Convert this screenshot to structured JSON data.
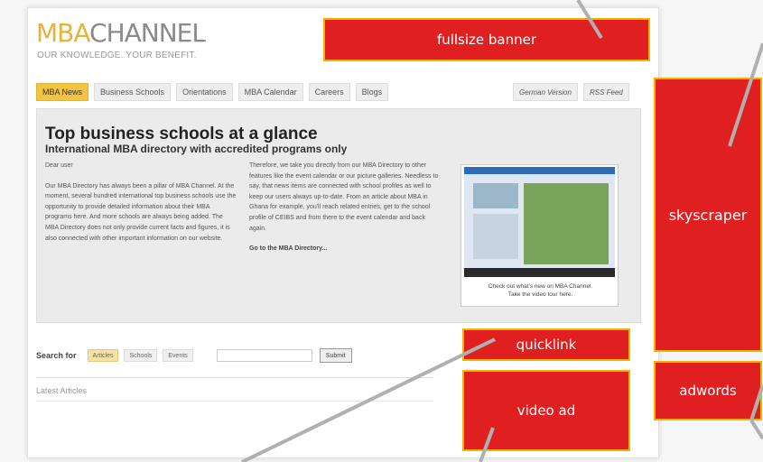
{
  "logo": {
    "part1": "MBA",
    "part2": "CHANNEL",
    "tagline": "OUR KNOWLEDGE. YOUR BENEFIT."
  },
  "nav": {
    "tabs": [
      "MBA News",
      "Business Schools",
      "Orientations",
      "MBA Calendar",
      "Careers",
      "Blogs"
    ],
    "active_tab": "MBA News",
    "right": [
      "German Version",
      "RSS Feed"
    ]
  },
  "hero": {
    "title": "Top business schools at a glance",
    "subtitle": "International MBA directory with accredited programs only",
    "col1": {
      "greeting": "Dear user",
      "body": "Our MBA Directory has always been a pillar of MBA Channel. At the moment, several hundred international top business schools use the opportunity to provide detailed information about their MBA programs here. And more schools are always being added. The MBA Directory does not only provide current facts and figures, it is also connected with other important information on our website."
    },
    "col2": {
      "body": "Therefore, we take you directly from our MBA Directory to other features like the event calendar or our picture galleries. Needless to say, that news items are connected with school profiles as well to keep our users always up-to-date. From an article about MBA in Ghana for example, you'll reach related entries, get to the school profile of CEIBS and from there to the event calendar and back again.",
      "link": "Go to the MBA Directory..."
    },
    "video_caption_1": "Check out what's new on MBA Channel.",
    "video_caption_2": "Take the video tour here."
  },
  "search": {
    "label": "Search for",
    "options": [
      "Articles",
      "Schools",
      "Events"
    ],
    "active_option": "Articles",
    "input_value": "",
    "submit": "Submit"
  },
  "latest": {
    "heading": "Latest Articles"
  },
  "ads": {
    "fullsize_banner": "fullsize banner",
    "skyscraper": "skyscraper",
    "quicklink": "quicklink",
    "adwords": "adwords",
    "video_ad": "video ad"
  },
  "colors": {
    "ad_red": "#e02020",
    "ad_border": "#f3b100",
    "brand_gold": "#e4b33a",
    "pointer_gray": "#b0b0b0"
  }
}
